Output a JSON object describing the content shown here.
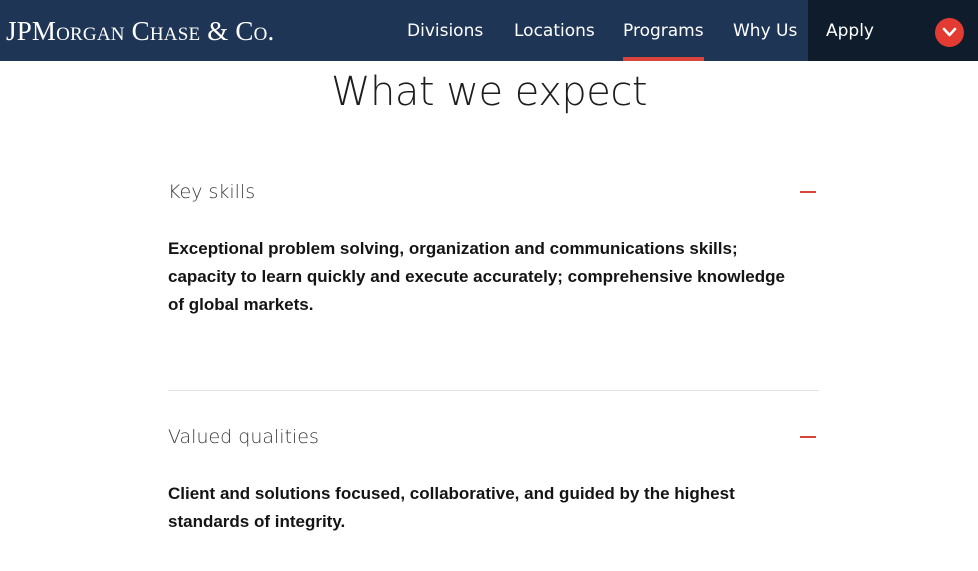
{
  "header": {
    "logo_text": "JPMorgan Chase & Co.",
    "nav": [
      {
        "label": "Divisions"
      },
      {
        "label": "Locations"
      },
      {
        "label": "Programs",
        "active": true
      },
      {
        "label": "Why Us"
      }
    ],
    "apply_label": "Apply",
    "accent_color": "#d9453b",
    "bar_color": "#1f3556"
  },
  "page": {
    "title": "What we expect"
  },
  "sections": [
    {
      "title": "Key skills",
      "toggle_icon": "minus-icon",
      "body": "Exceptional problem solving, organization and communications skills; capacity to learn quickly and execute accurately; comprehensive knowledge of global markets."
    },
    {
      "title": "Valued qualities",
      "toggle_icon": "minus-icon",
      "body": "Client and solutions focused, collaborative, and guided by the highest standards of integrity."
    }
  ]
}
